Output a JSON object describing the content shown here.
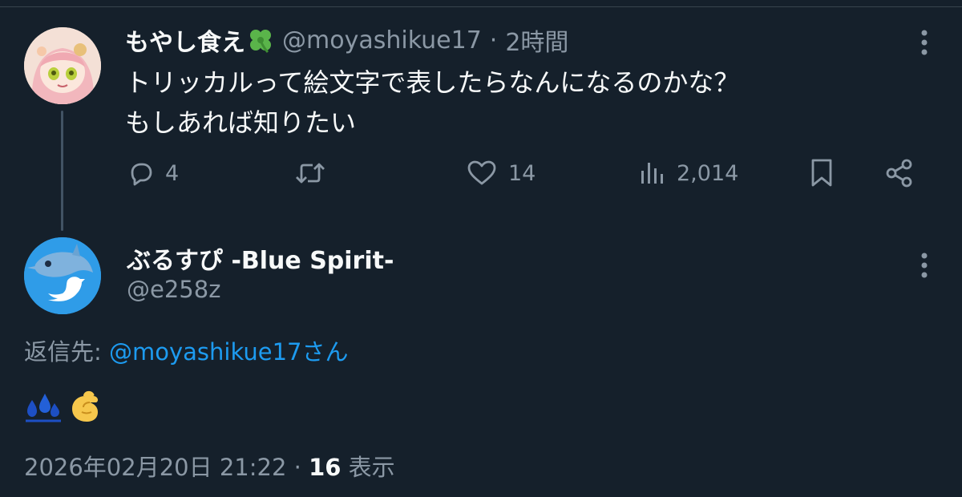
{
  "parent_tweet": {
    "display_name": "もやし食え",
    "name_emoji_icon": "four-leaf-clover-icon",
    "handle": "@moyashikue17",
    "separator": "·",
    "time_ago": "2時間",
    "text_line1": "トリッカルって絵文字で表したらなんになるのかな？",
    "text_line2": "もしあれば知りたい",
    "actions": {
      "reply_count": "4",
      "retweet_count": "",
      "like_count": "14",
      "view_count": "2,014"
    }
  },
  "reply_tweet": {
    "display_name": "ぶるすぴ -Blue Spirit-",
    "handle": "@e258z",
    "avatar_icon": "dolphin-twitter-bird-avatar",
    "reply_to_label": "返信先: ",
    "reply_to_handle": "@moyashikue17さん",
    "emoji_content": [
      "sweat-droplets-icon",
      "pinching-hand-icon"
    ],
    "date": "2026年02月20日 21:22",
    "separator": " · ",
    "view_count": "16",
    "view_label": " 表示"
  },
  "colors": {
    "background": "#15202b",
    "primary_text": "#f7f9f9",
    "secondary_text": "#8b98a5",
    "link": "#1d9bf0",
    "thread_line": "#425364"
  }
}
